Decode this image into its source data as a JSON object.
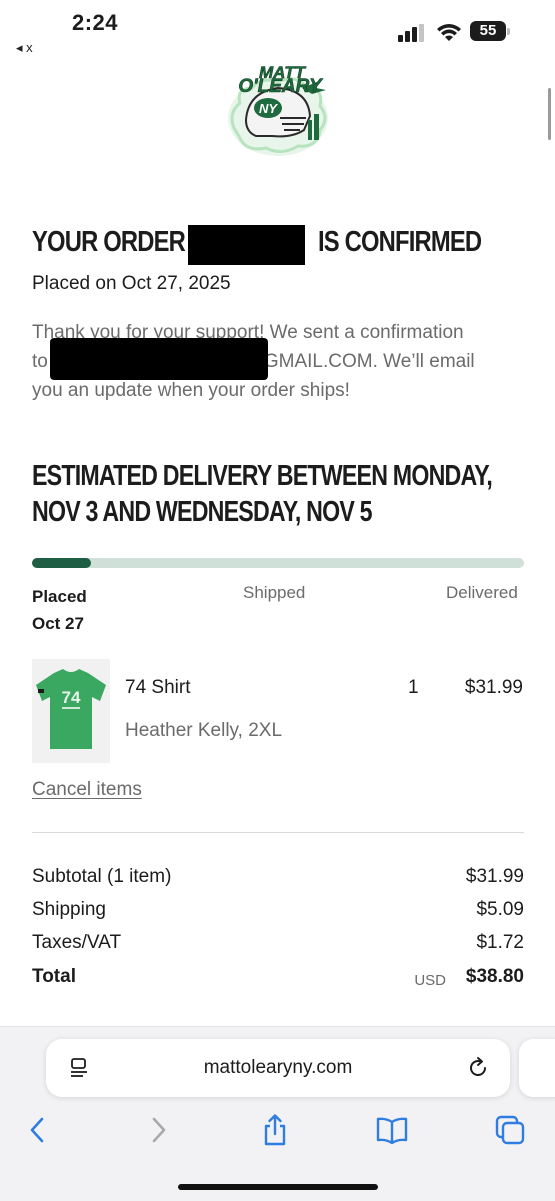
{
  "status": {
    "time": "2:24",
    "back_app": "◂ x",
    "battery": "55"
  },
  "order": {
    "heading_prefix": "YOUR ORDER #",
    "heading_suffix": "IS CONFIRMED",
    "placed_on": "Placed on Oct 27, 2025",
    "thanks_line1": "Thank you for your support! We sent a confirmation",
    "thanks_line2_prefix": "to",
    "thanks_line2_suffix": "GMAIL.COM. We’ll email",
    "thanks_line3": "you an update when your order ships!"
  },
  "delivery": {
    "line1": "ESTIMATED DELIVERY BETWEEN MONDAY,",
    "line2": "NOV 3 AND WEDNESDAY, NOV 5",
    "progress_fraction": 0.12,
    "steps": {
      "placed": "Placed",
      "placed_date": "Oct 27",
      "shipped": "Shipped",
      "delivered": "Delivered"
    }
  },
  "item": {
    "name": "74 Shirt",
    "variant": "Heather Kelly, 2XL",
    "quantity": "1",
    "price": "$31.99",
    "shirt_number": "74",
    "color": "#3aa860"
  },
  "cancel_link": "Cancel items",
  "summary": {
    "subtotal_label": "Subtotal (1 item)",
    "subtotal_value": "$31.99",
    "shipping_label": "Shipping",
    "shipping_value": "$5.09",
    "taxes_label": "Taxes/VAT",
    "taxes_value": "$1.72",
    "total_label": "Total",
    "total_currency": "USD",
    "total_value": "$38.80"
  },
  "browser": {
    "url": "mattolearyny.com"
  },
  "colors": {
    "progress_fill": "#1d5e45",
    "progress_track": "#cfe0d9",
    "brand_green": "#1f6b3f",
    "link_blue": "#2f7de1"
  }
}
